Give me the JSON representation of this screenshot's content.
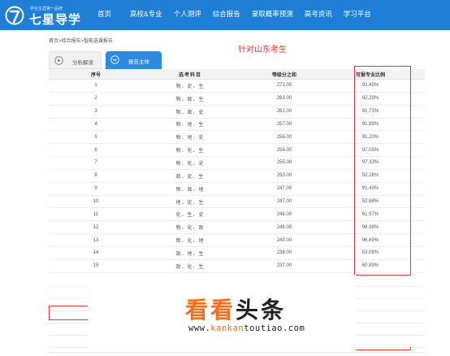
{
  "brand": {
    "tagline": "学业生涯第一品牌",
    "name": "七星导学",
    "logo_icon": "seven-logo-icon",
    "colors": {
      "header": "#1f7fd6",
      "accent": "#2d8ae3",
      "highlight": "#e53935"
    }
  },
  "nav": {
    "items": [
      {
        "label": "首页"
      },
      {
        "label": "高校&专业"
      },
      {
        "label": "个人测评"
      },
      {
        "label": "综合报告"
      },
      {
        "label": "录取概率预测"
      },
      {
        "label": "高考资讯"
      },
      {
        "label": "学习平台"
      }
    ]
  },
  "breadcrumb": {
    "text": "首页>综合报告>智能选课报告"
  },
  "annotation": "针对山东考生",
  "tabs": [
    {
      "label": "分析解读",
      "icon": "play-circle-icon"
    },
    {
      "label": "报告主体",
      "icon": "chevron-down-circle-icon"
    }
  ],
  "table": {
    "columns": [
      "序号",
      "选考科目",
      "等级分之和",
      "可报专业比例"
    ],
    "rows": [
      [
        "1",
        "物、史、生",
        "272.00",
        "92.49%"
      ],
      [
        "2",
        "物、政、生",
        "263.00",
        "92.29%"
      ],
      [
        "3",
        "物、政、史",
        "262.00",
        "91.73%"
      ],
      [
        "4",
        "物、地、生",
        "257.00",
        "91.89%"
      ],
      [
        "5",
        "物、地、史",
        "256.00",
        "91.20%"
      ],
      [
        "6",
        "物、化、生",
        "256.00",
        "97.05%"
      ],
      [
        "7",
        "物、化、史",
        "255.00",
        "97.33%"
      ],
      [
        "8",
        "政、史、生",
        "253.00",
        "52.26%"
      ],
      [
        "9",
        "物、政、地",
        "247.00",
        "91.49%"
      ],
      [
        "10",
        "地、史、生",
        "247.00",
        "52.88%"
      ],
      [
        "11",
        "化、生、史",
        "246.00",
        "61.97%"
      ],
      [
        "12",
        "物、化、政",
        "246.00",
        "96.98%"
      ],
      [
        "13",
        "物、化、地",
        "240.00",
        "96.69%"
      ],
      [
        "14",
        "政、地、生",
        "238.00",
        "53.08%"
      ],
      [
        "15",
        "政、化、生",
        "237.00",
        "60.89%"
      ]
    ]
  },
  "watermark": {
    "big_orange": "看看",
    "big_dark": "头条",
    "url_prefix": "www.",
    "url_accent": "kankan",
    "url_suffix": "toutiao.com"
  }
}
